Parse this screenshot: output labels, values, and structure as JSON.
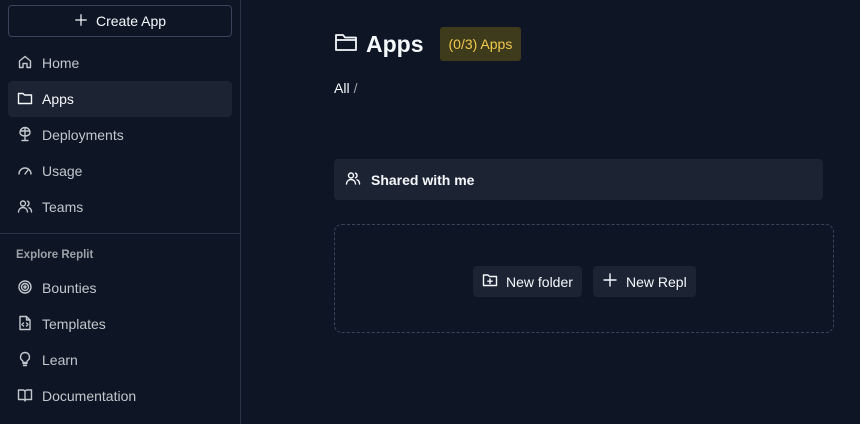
{
  "sidebar": {
    "create_button": {
      "label": "Create App",
      "icon": "plus-icon"
    },
    "nav": [
      {
        "label": "Home",
        "icon": "home-icon",
        "active": false
      },
      {
        "label": "Apps",
        "icon": "folder-icon",
        "active": true
      },
      {
        "label": "Deployments",
        "icon": "deployments-icon",
        "active": false
      },
      {
        "label": "Usage",
        "icon": "gauge-icon",
        "active": false
      },
      {
        "label": "Teams",
        "icon": "teams-icon",
        "active": false
      }
    ],
    "explore_label": "Explore Replit",
    "explore": [
      {
        "label": "Bounties",
        "icon": "bounties-icon"
      },
      {
        "label": "Templates",
        "icon": "template-icon"
      },
      {
        "label": "Learn",
        "icon": "lightbulb-icon"
      },
      {
        "label": "Documentation",
        "icon": "book-icon"
      }
    ]
  },
  "main": {
    "title": "Apps",
    "badge": "(0/3) Apps",
    "breadcrumb": {
      "root": "All",
      "separator": "/"
    },
    "shared_label": "Shared with me",
    "new_folder_label": "New folder",
    "new_repl_label": "New Repl"
  },
  "colors": {
    "background": "#0e1525",
    "surface": "#1c2333",
    "border": "#2b3245",
    "badge_bg": "#3e3a1c",
    "badge_text": "#f2c94c"
  }
}
